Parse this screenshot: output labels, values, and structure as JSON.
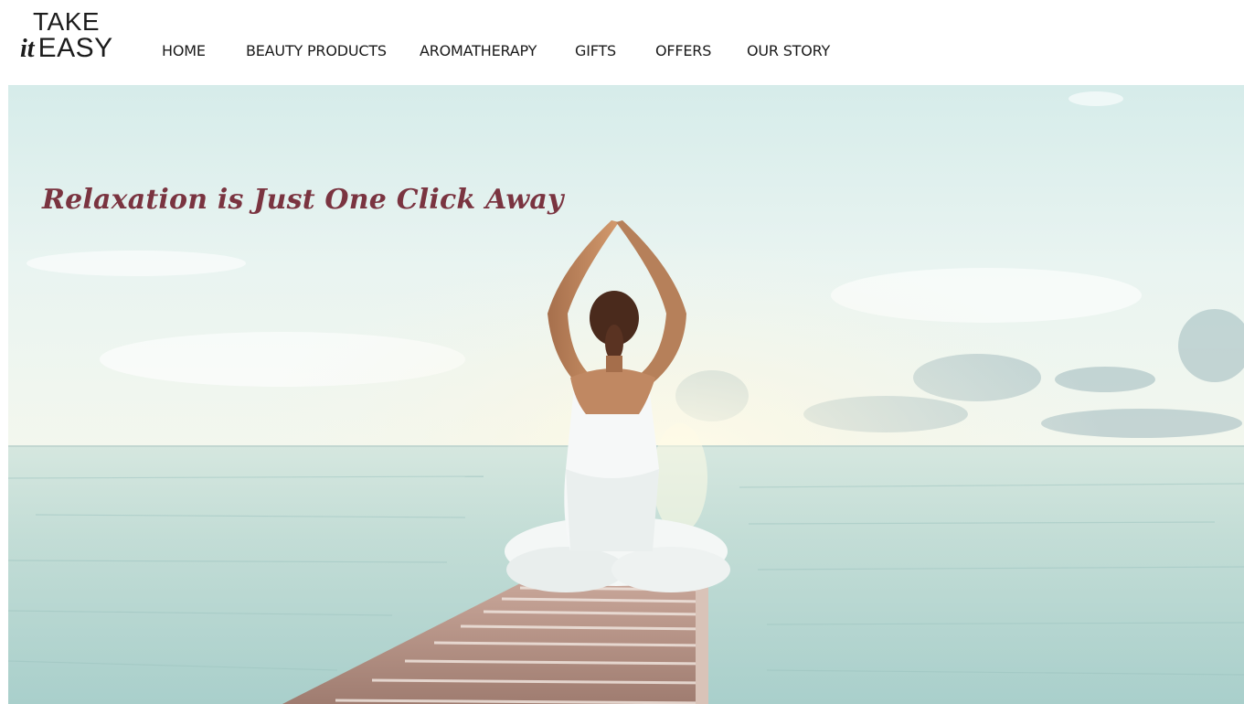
{
  "brand": {
    "logo_line1": "TAKE",
    "logo_it": "it",
    "logo_easy": "EASY"
  },
  "nav": {
    "items": [
      {
        "label": "HOME"
      },
      {
        "label": "BEAUTY PRODUCTS"
      },
      {
        "label": "AROMATHERAPY"
      },
      {
        "label": "GIFTS"
      },
      {
        "label": "OFFERS"
      },
      {
        "label": "OUR STORY"
      }
    ]
  },
  "hero": {
    "tagline": "Relaxation is Just One Click Away"
  },
  "colors": {
    "tagline": "#7a3440",
    "nav_text": "#1a1a1a",
    "sky": "#dff0ee",
    "sea": "#b8d8d4"
  }
}
